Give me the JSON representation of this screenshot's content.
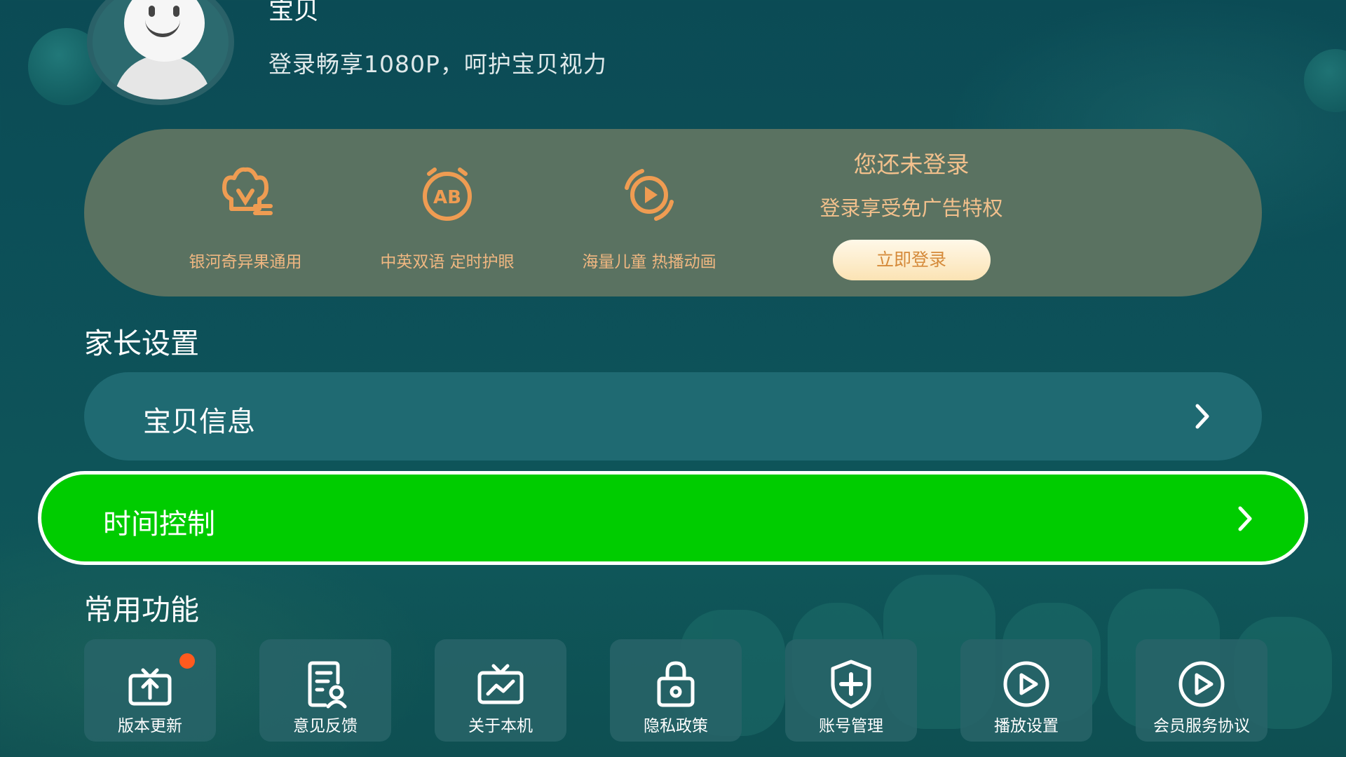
{
  "profile": {
    "name": "宝贝",
    "subtitle": "登录畅享1080P，呵护宝贝视力"
  },
  "vip_card": {
    "features": [
      {
        "icon": "crown-icon",
        "label": "银河奇异果通用"
      },
      {
        "icon": "ab-bilingual-icon",
        "label": "中英双语 定时护眼"
      },
      {
        "icon": "play-circle-icon",
        "label": "海量儿童 热播动画"
      }
    ],
    "login_title": "您还未登录",
    "login_subtitle": "登录享受免广告特权",
    "login_button": "立即登录",
    "accent_color": "#f2c08c"
  },
  "parent_settings": {
    "title": "家长设置",
    "items": [
      {
        "label": "宝贝信息",
        "focused": false
      },
      {
        "label": "时间控制",
        "focused": true
      }
    ]
  },
  "common_functions": {
    "title": "常用功能",
    "items": [
      {
        "label": "版本更新",
        "icon": "upload-update-icon",
        "badge": true
      },
      {
        "label": "意见反馈",
        "icon": "feedback-icon"
      },
      {
        "label": "关于本机",
        "icon": "tv-icon"
      },
      {
        "label": "隐私政策",
        "icon": "lock-icon"
      },
      {
        "label": "账号管理",
        "icon": "shield-plus-icon"
      },
      {
        "label": "播放设置",
        "icon": "play-circle-icon"
      },
      {
        "label": "会员服务协议",
        "icon": "play-circle-icon"
      }
    ]
  },
  "colors": {
    "focus_green": "#00cc00",
    "badge_orange": "#ff5a1e"
  }
}
